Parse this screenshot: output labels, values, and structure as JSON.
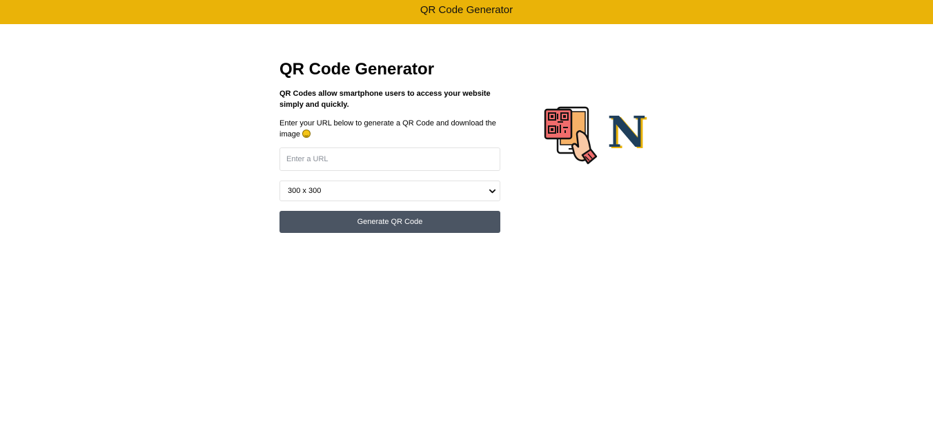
{
  "header": {
    "title": "QR Code Generator"
  },
  "main": {
    "title": "QR Code Generator",
    "lead": "QR Codes allow smartphone users to access your website simply and quickly.",
    "instruction": "Enter your URL below to generate a QR Code and download the image",
    "url_input": {
      "value": "",
      "placeholder": "Enter a URL"
    },
    "size_select": {
      "selected": "300 x 300"
    },
    "generate_button": "Generate QR Code"
  },
  "logo": {
    "letter": "N"
  },
  "colors": {
    "header_bg": "#eab308",
    "button_bg": "#4b5563",
    "logo_navy": "#1f3f5b",
    "logo_gold": "#eab308"
  },
  "icons": [
    "smiling-face-icon",
    "chevron-down-icon",
    "qr-phone-scan-icon"
  ]
}
